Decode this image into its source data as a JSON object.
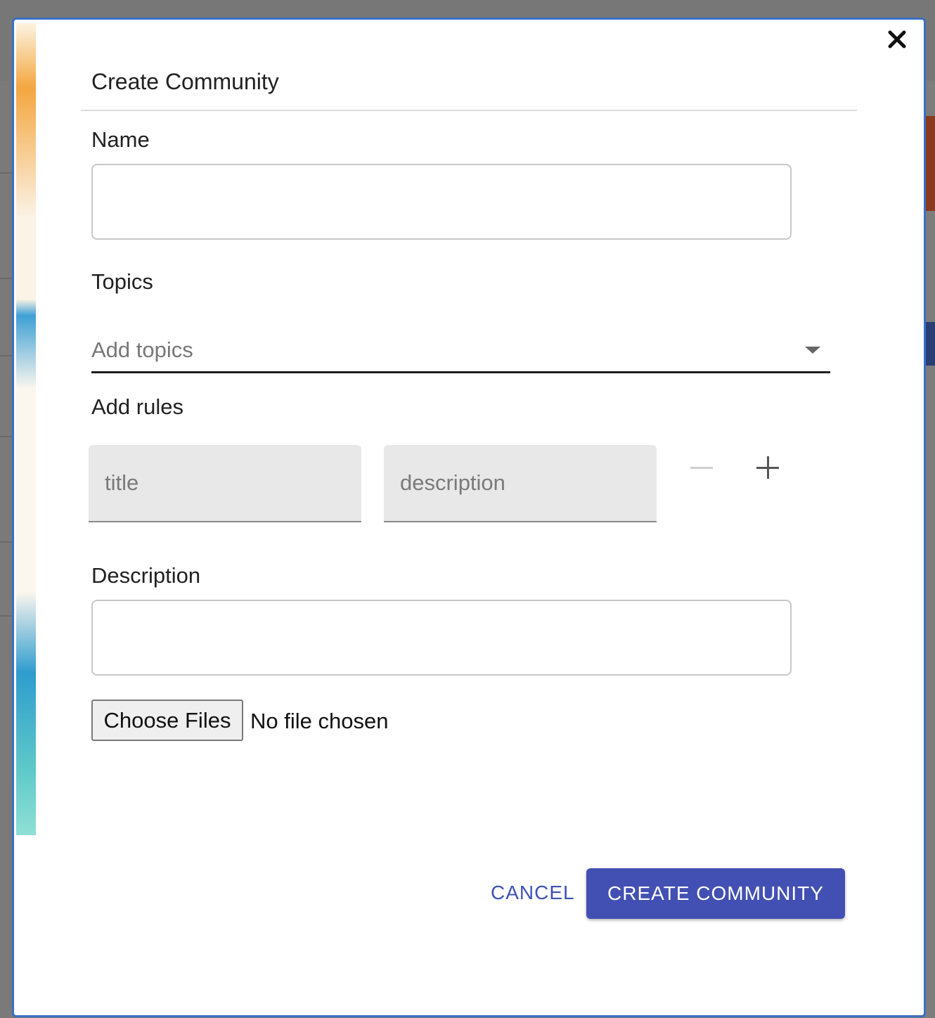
{
  "dialog": {
    "title": "Create Community",
    "close_icon": "close-icon"
  },
  "form": {
    "name_label": "Name",
    "name_value": "",
    "topics_label": "Topics",
    "topics_placeholder": "Add topics",
    "rules_label": "Add rules",
    "rule_title_placeholder": "title",
    "rule_description_placeholder": "description",
    "description_label": "Description",
    "description_value": "",
    "file_button_label": "Choose Files",
    "file_status": "No file chosen"
  },
  "actions": {
    "cancel_label": "CANCEL",
    "create_label": "CREATE COMMUNITY"
  },
  "colors": {
    "primary": "#4350b3",
    "modal_border": "#3a6fc4",
    "overlay": "#7d7d7d"
  }
}
